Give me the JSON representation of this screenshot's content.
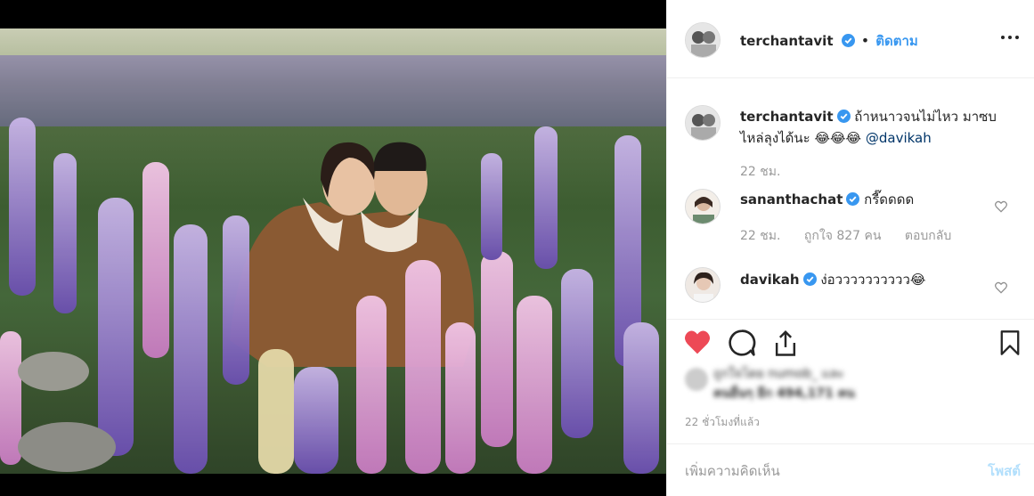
{
  "post": {
    "image_alt": "Couple among lupine flowers"
  },
  "header": {
    "username": "terchantavit",
    "separator": "•",
    "follow_label": "ติดตาม"
  },
  "caption": {
    "username": "terchantavit",
    "text": "ถ้าหนาวจนไม่ไหว มาซบไหล่ลุงได้นะ 😂😂😂",
    "mention": "@davikah",
    "time": "22 ชม."
  },
  "comments": [
    {
      "username": "sananthachat",
      "text": "กรี๊ดดดด",
      "time": "22 ชม.",
      "likes": "ถูกใจ 827 คน",
      "reply_label": "ตอบกลับ"
    },
    {
      "username": "davikah",
      "text": "ง่อวววววววววว😂"
    }
  ],
  "likes": {
    "line1": "ถูกใจโดย numob_ และ",
    "line2": "คนอื่นๆ อีก 494,171 คน"
  },
  "time_ago": "22 ชั่วโมงที่แล้ว",
  "add_comment": {
    "placeholder": "เพิ่มความคิดเห็น",
    "post_label": "โพสต์"
  },
  "colors": {
    "accent": "#3897f0",
    "liked": "#ed4956",
    "verified": "#3897f0",
    "post_disabled": "#b2dffc"
  },
  "icons": [
    "verified-icon",
    "more-options-icon",
    "heart-icon",
    "comment-icon",
    "share-icon",
    "bookmark-icon"
  ]
}
